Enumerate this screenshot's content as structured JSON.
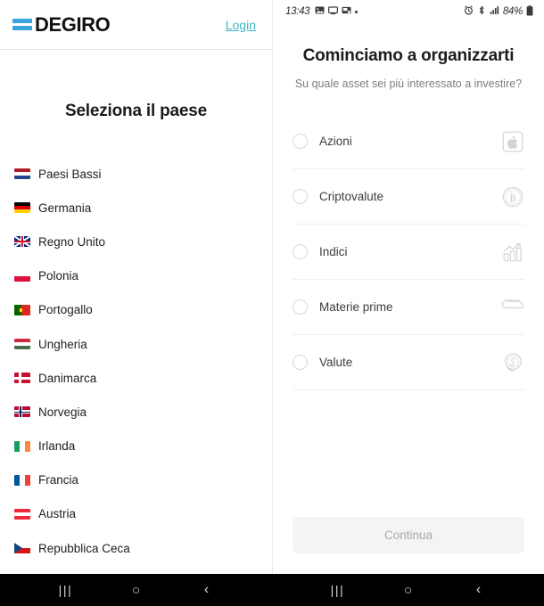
{
  "left_panel": {
    "brand": {
      "logo_mark": "degiro-bars-icon",
      "name": "DEGIRO",
      "accent_color": "#3ba3dd"
    },
    "login_label": "Login",
    "login_color": "#3fb4c4",
    "heading": "Seleziona il paese",
    "countries": [
      {
        "name": "Paesi Bassi",
        "flag": "f-nl"
      },
      {
        "name": "Germania",
        "flag": "f-de"
      },
      {
        "name": "Regno Unito",
        "flag": "f-gb"
      },
      {
        "name": "Polonia",
        "flag": "f-pl"
      },
      {
        "name": "Portogallo",
        "flag": "f-pt"
      },
      {
        "name": "Ungheria",
        "flag": "f-hu"
      },
      {
        "name": "Danimarca",
        "flag": "f-dk"
      },
      {
        "name": "Norvegia",
        "flag": "f-no"
      },
      {
        "name": "Irlanda",
        "flag": "f-ie"
      },
      {
        "name": "Francia",
        "flag": "f-fr"
      },
      {
        "name": "Austria",
        "flag": "f-at"
      },
      {
        "name": "Repubblica Ceca",
        "flag": "f-cz"
      }
    ]
  },
  "right_panel": {
    "statusbar": {
      "time": "13:43",
      "left_icons": [
        "image-icon",
        "screen-cast-icon",
        "gallery-icon",
        "dot-icon"
      ],
      "right_icons": [
        "alarm-icon",
        "bluetooth-icon",
        "signal-icon"
      ],
      "battery_percent": "84%",
      "battery_icon": "battery-icon"
    },
    "title": "Cominciamo a organizzarti",
    "subtitle": "Su quale asset sei più interessato a investire?",
    "options": [
      {
        "label": "Azioni",
        "icon": "apple-stock-icon",
        "selected": false
      },
      {
        "label": "Criptovalute",
        "icon": "bitcoin-icon",
        "selected": false
      },
      {
        "label": "Indici",
        "icon": "bar-chart-arrow-icon",
        "selected": false
      },
      {
        "label": "Materie prime",
        "icon": "gold-bar-icon",
        "selected": false
      },
      {
        "label": "Valute",
        "icon": "coins-icon",
        "selected": false
      }
    ],
    "continue_label": "Continua",
    "continue_enabled": false
  },
  "navbar": {
    "recents": "|||",
    "home": "○",
    "back": "‹"
  }
}
